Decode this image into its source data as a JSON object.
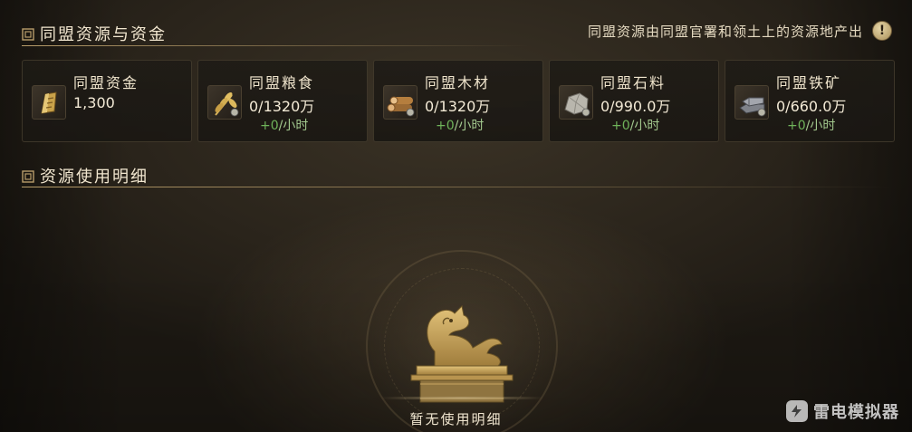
{
  "section_alliance_resources": {
    "title": "同盟资源与资金"
  },
  "notice": {
    "text": "同盟资源由同盟官署和领土上的资源地产出",
    "info_icon": "!"
  },
  "resources": [
    {
      "name": "同盟资金",
      "amount": "1,300",
      "rate": "",
      "rate_unit": "",
      "icon": "gold-ingot-icon"
    },
    {
      "name": "同盟粮食",
      "amount": "0/1320万",
      "rate": "+0",
      "rate_unit": "/小时",
      "icon": "wheat-icon"
    },
    {
      "name": "同盟木材",
      "amount": "0/1320万",
      "rate": "+0",
      "rate_unit": "/小时",
      "icon": "timber-icon"
    },
    {
      "name": "同盟石料",
      "amount": "0/990.0万",
      "rate": "+0",
      "rate_unit": "/小时",
      "icon": "stone-icon"
    },
    {
      "name": "同盟铁矿",
      "amount": "0/660.0万",
      "rate": "+0",
      "rate_unit": "/小时",
      "icon": "iron-ore-icon"
    }
  ],
  "section_usage_details": {
    "title": "资源使用明细"
  },
  "empty_state": {
    "text": "暂无使用明细"
  },
  "watermark": {
    "text": "雷电模拟器"
  },
  "colors": {
    "accent_gold": "#b89d6a",
    "rate_green": "#6fb35a",
    "text_light": "#efe4cc"
  }
}
